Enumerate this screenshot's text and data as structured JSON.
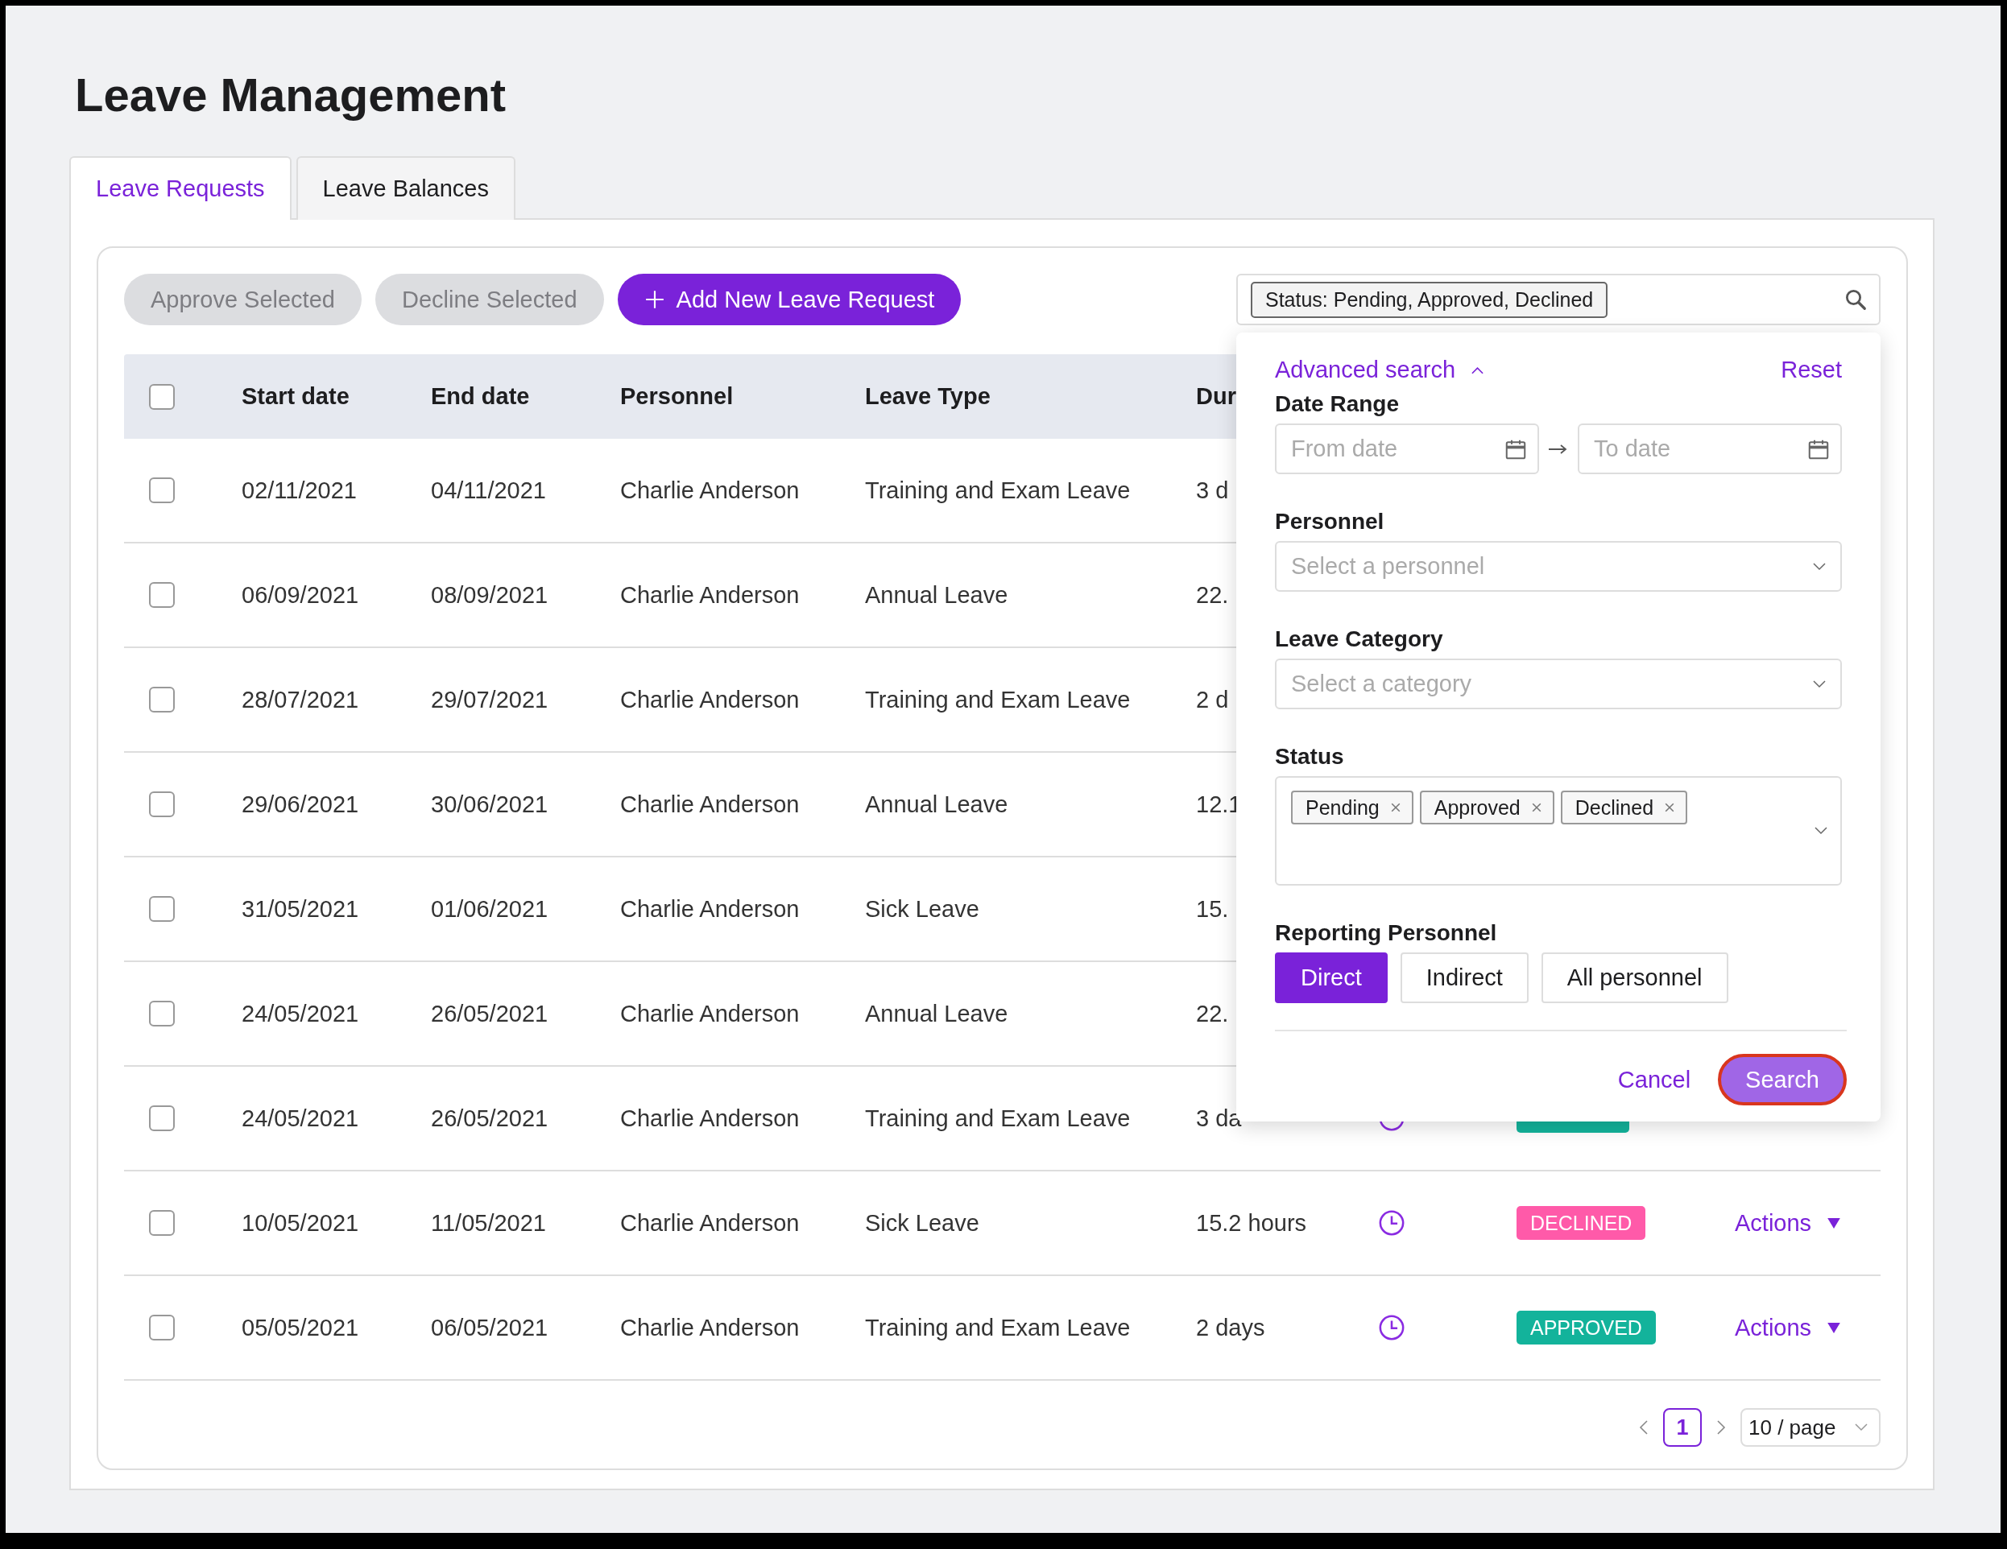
{
  "page_title": "Leave Management",
  "tabs": [
    {
      "label": "Leave Requests",
      "selected": true
    },
    {
      "label": "Leave Balances",
      "selected": false
    }
  ],
  "toolbar": {
    "buttons": [
      {
        "label": "Approve Selected",
        "kind": "secondary",
        "disabled": true
      },
      {
        "label": "Decline Selected",
        "kind": "secondary",
        "disabled": true
      },
      {
        "label": "Add New Leave Request",
        "kind": "primary",
        "disabled": false
      }
    ],
    "search": {
      "filter_tag": "Status: Pending, Approved, Declined"
    }
  },
  "table": {
    "select_all": {
      "checked": false
    },
    "columns": [
      "Start date",
      "End date",
      "Personnel",
      "Leave Type",
      "Dur"
    ],
    "rows": [
      {
        "checked": false,
        "start": "02/11/2021",
        "end": "04/11/2021",
        "personnel": "Charlie Anderson",
        "leave_type": "Training and Exam Leave",
        "duration": "3 d"
      },
      {
        "checked": false,
        "start": "06/09/2021",
        "end": "08/09/2021",
        "personnel": "Charlie Anderson",
        "leave_type": "Annual Leave",
        "duration": "22."
      },
      {
        "checked": false,
        "start": "28/07/2021",
        "end": "29/07/2021",
        "personnel": "Charlie Anderson",
        "leave_type": "Training and Exam Leave",
        "duration": "2 d"
      },
      {
        "checked": false,
        "start": "29/06/2021",
        "end": "30/06/2021",
        "personnel": "Charlie Anderson",
        "leave_type": "Annual Leave",
        "duration": "12.1"
      },
      {
        "checked": false,
        "start": "31/05/2021",
        "end": "01/06/2021",
        "personnel": "Charlie Anderson",
        "leave_type": "Sick Leave",
        "duration": "15."
      },
      {
        "checked": false,
        "start": "24/05/2021",
        "end": "26/05/2021",
        "personnel": "Charlie Anderson",
        "leave_type": "Annual Leave",
        "duration": "22."
      },
      {
        "checked": false,
        "start": "24/05/2021",
        "end": "26/05/2021",
        "personnel": "Charlie Anderson",
        "leave_type": "Training and Exam Leave",
        "duration": "3 da",
        "status": {
          "kind": "approved"
        }
      },
      {
        "checked": false,
        "start": "10/05/2021",
        "end": "11/05/2021",
        "personnel": "Charlie Anderson",
        "leave_type": "Sick Leave",
        "duration": "15.2 hours",
        "status": {
          "kind": "declined",
          "label": "DECLINED"
        },
        "actions": "Actions"
      },
      {
        "checked": false,
        "start": "05/05/2021",
        "end": "06/05/2021",
        "personnel": "Charlie Anderson",
        "leave_type": "Training and Exam Leave",
        "duration": "2 days",
        "status": {
          "kind": "approved",
          "label": "APPROVED"
        },
        "actions": "Actions"
      }
    ]
  },
  "pagination": {
    "pages": [
      {
        "label": "1",
        "selected": true
      }
    ],
    "page_size": "10 / page"
  },
  "advanced_search": {
    "title": "Advanced search",
    "expanded": true,
    "reset": "Reset",
    "date_range": {
      "label": "Date Range",
      "from_placeholder": "From date",
      "to_placeholder": "To date"
    },
    "personnel": {
      "label": "Personnel",
      "placeholder": "Select a personnel"
    },
    "leave_category": {
      "label": "Leave Category",
      "placeholder": "Select a category"
    },
    "status": {
      "label": "Status",
      "tags": [
        "Pending",
        "Approved",
        "Declined"
      ]
    },
    "reporting_personnel": {
      "label": "Reporting Personnel",
      "options": [
        {
          "label": "Direct",
          "selected": true
        },
        {
          "label": "Indirect",
          "selected": false
        },
        {
          "label": "All personnel",
          "selected": false
        }
      ]
    },
    "cancel": "Cancel",
    "search": "Search"
  }
}
